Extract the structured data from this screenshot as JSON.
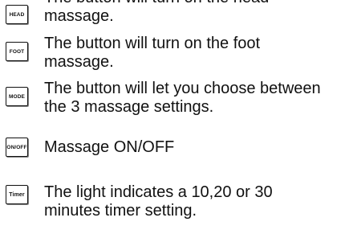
{
  "items": [
    {
      "button_label": "HEAD",
      "lines": [
        "The button will turn on the head",
        "massage."
      ]
    },
    {
      "button_label": "FOOT",
      "lines": [
        "The button will turn on the foot",
        "massage."
      ]
    },
    {
      "button_label": "MODE",
      "lines": [
        "The button will let you choose between",
        "the 3 massage settings."
      ]
    },
    {
      "button_label": "ON/OFF",
      "lines": [
        "Massage ON/OFF"
      ]
    },
    {
      "button_label": "Timer",
      "lines": [
        "The light indicates  a 10,20 or 30",
        "minutes timer setting."
      ]
    }
  ]
}
